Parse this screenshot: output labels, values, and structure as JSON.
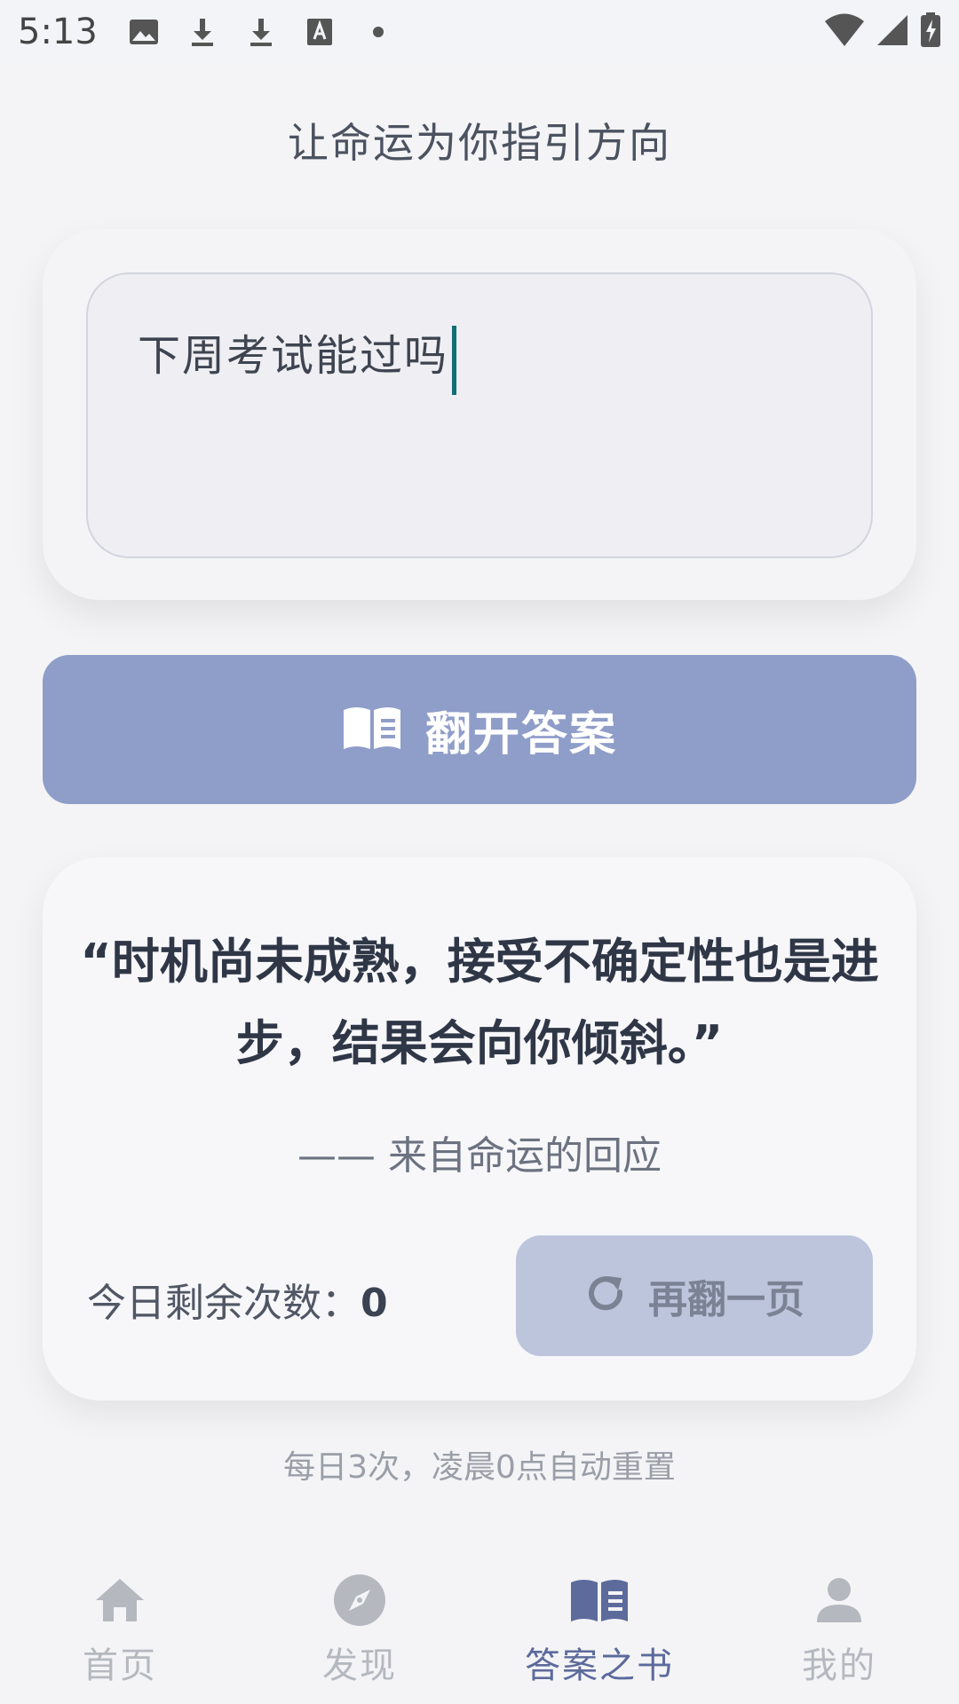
{
  "status_bar": {
    "time": "5:13"
  },
  "header": {
    "subtitle": "让命运为你指引方向"
  },
  "question": {
    "value": "下周考试能过吗"
  },
  "actions": {
    "open_label": "翻开答案"
  },
  "answer": {
    "quote": "“时机尚未成熟，接受不确定性也是进步，结果会向你倾斜。”",
    "source": "—— 来自命运的回应",
    "remaining_label": "今日剩余次数：",
    "remaining_count": "0",
    "again_label": "再翻一页"
  },
  "footer_note": "每日3次，凌晨0点自动重置",
  "nav": {
    "items": [
      {
        "label": "首页",
        "icon": "home-icon"
      },
      {
        "label": "发现",
        "icon": "compass-icon"
      },
      {
        "label": "答案之书",
        "icon": "book-icon",
        "active": true
      },
      {
        "label": "我的",
        "icon": "person-icon"
      }
    ]
  },
  "colors": {
    "primary": "#8f9dc9",
    "nav_active": "#5c6b9c",
    "caret": "#0f6f72"
  }
}
